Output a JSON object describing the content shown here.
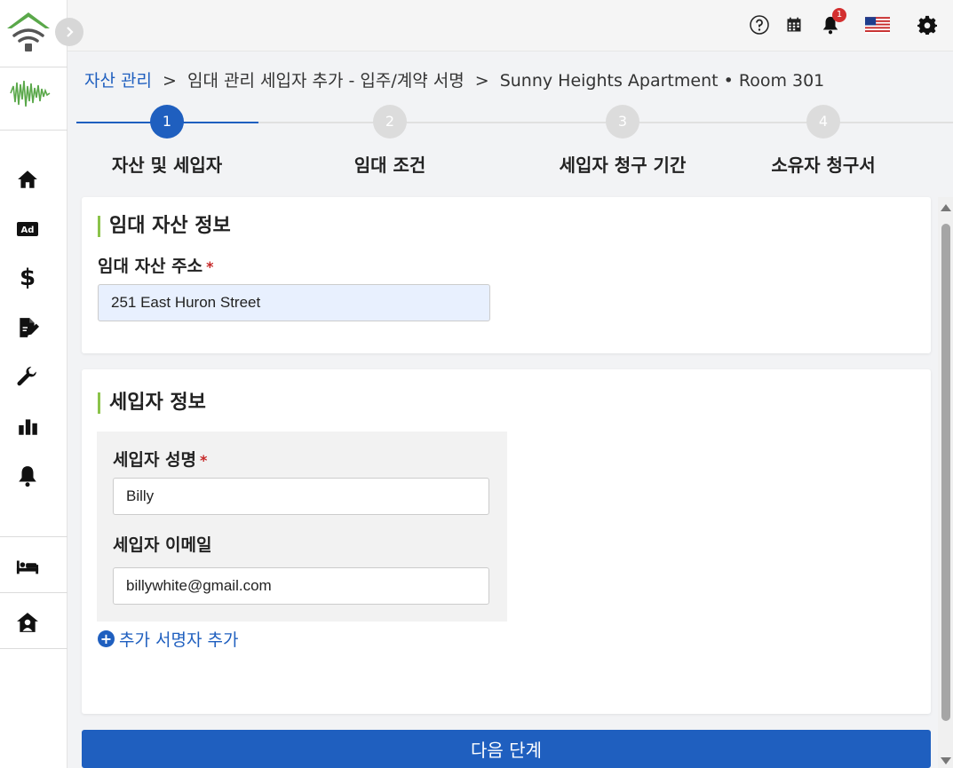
{
  "topbar": {
    "notification_count": "1",
    "icons": [
      "help-icon",
      "calendar-icon",
      "bell-icon",
      "flag-us-icon",
      "gear-icon"
    ]
  },
  "sidebar": {
    "icons": [
      "home-icon",
      "ad-icon",
      "dollar-icon",
      "document-edit-icon",
      "wrench-icon",
      "bar-chart-icon",
      "bell-icon",
      "bed-icon",
      "house-person-icon"
    ],
    "ad_label": "Ad",
    "dollar_label": "$"
  },
  "breadcrumb": {
    "root": "자산 관리",
    "sep1": ">",
    "middle": "임대 관리 세입자 추가 - 입주/계약 서명",
    "sep2": ">",
    "current": "Sunny Heights Apartment • Room 301"
  },
  "stepper": {
    "steps": [
      {
        "number": "1",
        "label": "자산 및 세입자"
      },
      {
        "number": "2",
        "label": "임대 조건"
      },
      {
        "number": "3",
        "label": "세입자 청구 기간"
      },
      {
        "number": "4",
        "label": "소유자 청구서"
      }
    ],
    "active_step": 1
  },
  "property_card": {
    "title": "임대 자산 정보",
    "address_label": "임대 자산 주소",
    "required_mark": "*",
    "address_value": "251 East Huron Street"
  },
  "tenant_card": {
    "title": "세입자 정보",
    "name_label": "세입자 성명",
    "required_mark": "*",
    "name_value": "Billy",
    "email_label": "세입자 이메일",
    "email_value": "billywhite@gmail.com",
    "add_signer_icon": "+",
    "add_signer_label": "추가 서명자 추가"
  },
  "next_button": "다음 단계",
  "colors": {
    "primary": "#1f5fbf",
    "accent_green": "#8bc34a",
    "badge_red": "#d32f2f",
    "logo_green": "#5aa84a"
  }
}
